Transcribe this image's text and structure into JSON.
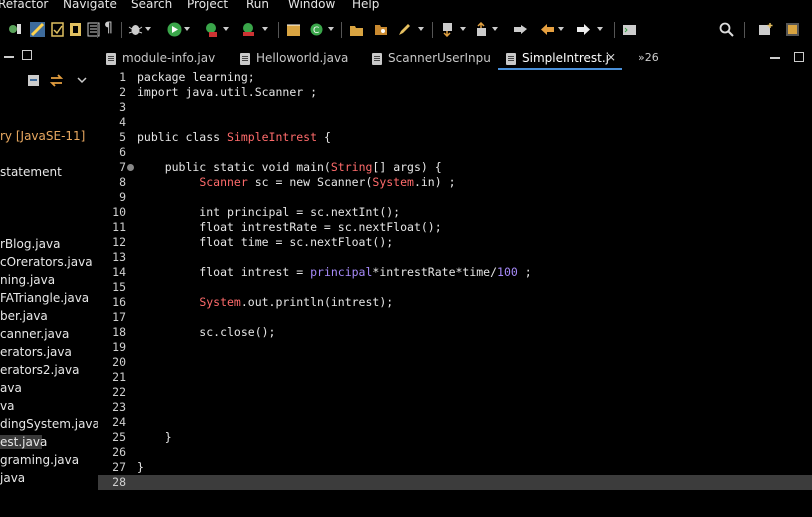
{
  "menubar": {
    "items": [
      "Refactor",
      "Navigate",
      "Search",
      "Project",
      "Run",
      "Window",
      "Help"
    ]
  },
  "left_panel": {
    "items": [
      "ry [JavaSE-11]",
      "statement",
      "rBlog.java",
      "cOrerators.java",
      "ning.java",
      "FATriangle.java",
      "ber.java",
      "canner.java",
      "erators.java",
      "erators2.java",
      "ava",
      "va",
      "dingSystem.java",
      "est.java",
      "graming.java",
      "java"
    ],
    "selected_index": 13,
    "jre_label_color": "#e8a860"
  },
  "editor": {
    "tabs": [
      {
        "label": "module-info.jav",
        "active": false
      },
      {
        "label": "Helloworld.java",
        "active": false
      },
      {
        "label": "ScannerUserInpu",
        "active": false
      },
      {
        "label": "SimpleIntrest.j",
        "active": true
      }
    ],
    "overflow_label": "»26",
    "lines": [
      {
        "n": "1",
        "html": "package learning;"
      },
      {
        "n": "2",
        "html": "import java.util.Scanner ;"
      },
      {
        "n": "3",
        "html": ""
      },
      {
        "n": "4",
        "html": ""
      },
      {
        "n": "5",
        "html": "public class <span class='cls'>SimpleIntrest</span> {"
      },
      {
        "n": "6",
        "html": ""
      },
      {
        "n": "7",
        "html": "    public static void main(<span class='cls'>String</span>[] args) {"
      },
      {
        "n": "8",
        "html": "         <span class='cls'>Scanner</span> sc = new Scanner(<span class='cls'>System</span>.in) ;"
      },
      {
        "n": "9",
        "html": ""
      },
      {
        "n": "10",
        "html": "         int principal = sc.nextInt();"
      },
      {
        "n": "11",
        "html": "         float intrestRate = sc.nextFloat();"
      },
      {
        "n": "12",
        "html": "         float time = sc.nextFloat();"
      },
      {
        "n": "13",
        "html": ""
      },
      {
        "n": "14",
        "html": "         float intrest = <span class='fld'>principal</span>*intrestRate*time/<span class='num'>100</span> ;"
      },
      {
        "n": "15",
        "html": ""
      },
      {
        "n": "16",
        "html": "         <span class='cls'>System</span>.out.println(intrest);"
      },
      {
        "n": "17",
        "html": ""
      },
      {
        "n": "18",
        "html": "         sc.close();"
      },
      {
        "n": "19",
        "html": ""
      },
      {
        "n": "20",
        "html": ""
      },
      {
        "n": "21",
        "html": ""
      },
      {
        "n": "22",
        "html": ""
      },
      {
        "n": "23",
        "html": ""
      },
      {
        "n": "24",
        "html": ""
      },
      {
        "n": "25",
        "html": "    }"
      },
      {
        "n": "26",
        "html": ""
      },
      {
        "n": "27",
        "html": "}"
      },
      {
        "n": "28",
        "html": ""
      }
    ]
  },
  "colors": {
    "background": "#000000",
    "class_ref": "#ff6b6b",
    "field_ref": "#a78bfa",
    "active_tab_underline": "#4a90d9"
  }
}
